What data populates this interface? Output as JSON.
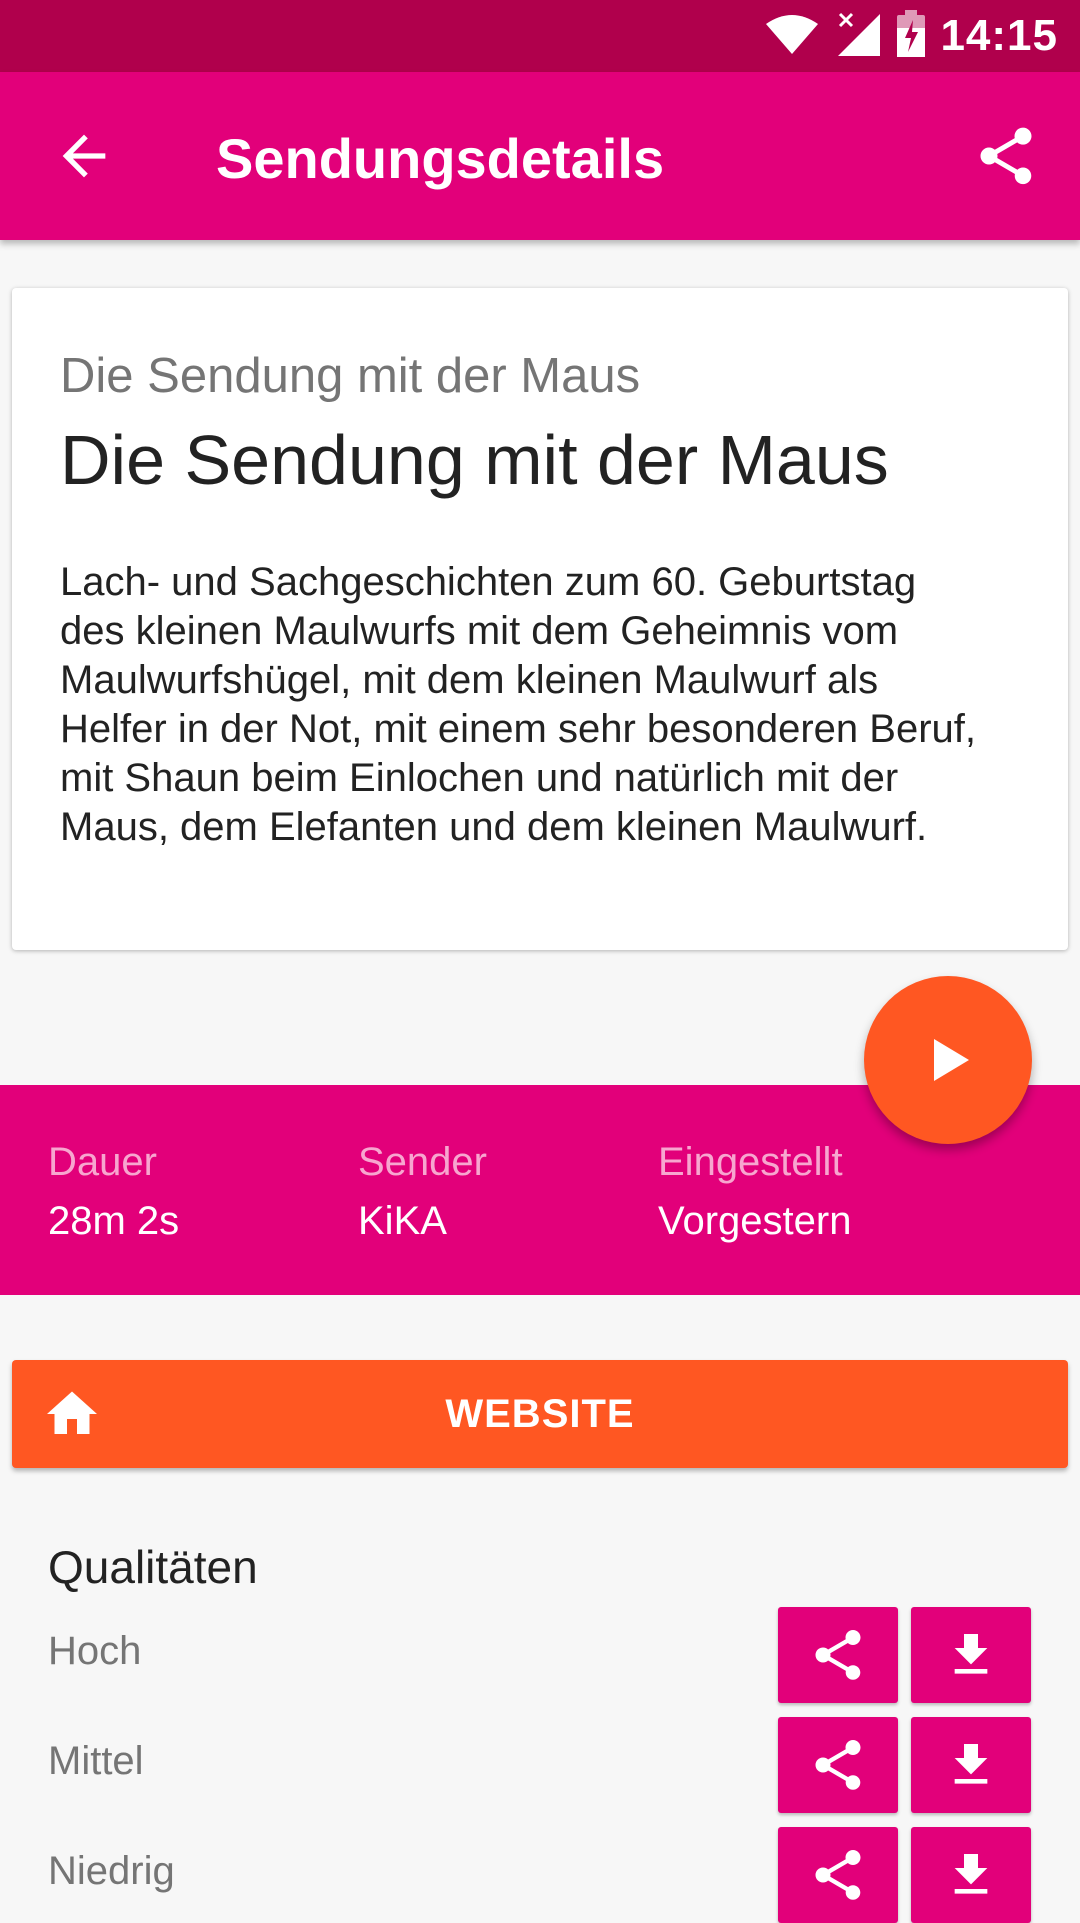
{
  "status_bar": {
    "time": "14:15"
  },
  "app_bar": {
    "title": "Sendungsdetails"
  },
  "show": {
    "subtitle": "Die Sendung mit der Maus",
    "title": "Die Sendung mit der Maus",
    "description_lines": [
      "Lach- und Sachgeschichten zum 60. Geburtstag",
      "des kleinen Maulwurfs mit dem Geheimnis vom",
      "Maulwurfshügel, mit dem kleinen Maulwurf als",
      "Helfer in der Not, mit einem sehr besonderen Beruf,",
      "mit Shaun beim Einlochen und natürlich mit der",
      "Maus, dem Elefanten und dem kleinen Maulwurf."
    ]
  },
  "info": {
    "duration": {
      "label": "Dauer",
      "value": "28m 2s"
    },
    "channel": {
      "label": "Sender",
      "value": "KiKA"
    },
    "added": {
      "label": "Eingestellt",
      "value": "Vorgestern"
    }
  },
  "website_button": {
    "label": "WEBSITE"
  },
  "qualities": {
    "title": "Qualitäten",
    "items": [
      {
        "label": "Hoch"
      },
      {
        "label": "Mittel"
      },
      {
        "label": "Niedrig"
      }
    ]
  },
  "colors": {
    "status_bar": "#b0004c",
    "primary": "#e2007a",
    "accent": "#ff5722"
  },
  "icons": {
    "back": "arrow-back-icon",
    "share": "share-icon",
    "play": "play-icon",
    "home": "home-icon",
    "download": "download-icon",
    "wifi": "wifi-icon",
    "signal": "signal-icon",
    "battery": "battery-icon"
  }
}
